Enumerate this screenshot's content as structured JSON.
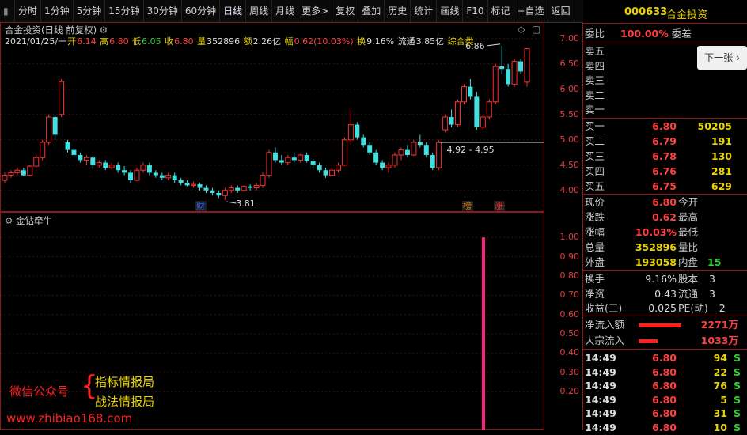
{
  "toolbar": {
    "items": [
      "分时",
      "1分钟",
      "5分钟",
      "15分钟",
      "30分钟",
      "60分钟",
      "日线",
      "周线",
      "月线",
      "更多>",
      "复权",
      "叠加",
      "历史",
      "统计",
      "画线",
      "F10",
      "标记",
      "+自选",
      "返回"
    ],
    "active": "日线"
  },
  "header": {
    "title": "合金投资(日线 前复权)",
    "date": "2021/01/25/一",
    "open_label": "开",
    "open": "6.14",
    "high_label": "高",
    "high": "6.80",
    "low_label": "低",
    "low": "6.05",
    "close_label": "收",
    "close": "6.80",
    "vol_label": "量",
    "vol": "352896",
    "amt_label": "额",
    "amt": "2.26亿",
    "chg_label": "幅",
    "chg": "0.62(10.03%)",
    "turn_label": "换",
    "turn": "9.16%",
    "float_label": "流通",
    "float": "3.85亿",
    "sector": "综合类"
  },
  "price_axis": [
    "7.00",
    "6.50",
    "6.00",
    "5.50",
    "5.00",
    "4.50",
    "4.00"
  ],
  "indicator": {
    "name": "金钻牵牛",
    "axis": [
      "1.00",
      "0.90",
      "0.80",
      "0.70",
      "0.60",
      "0.50",
      "0.40",
      "0.30",
      "0.20"
    ],
    "bar_value": 1.0
  },
  "annotations": {
    "high_mark": "6.86",
    "low_mark": "3.81",
    "range_label": "4.92 - 4.95",
    "tag_cai": "财",
    "tag_bang": "榜",
    "tag_zhang": "涨"
  },
  "chart_data": {
    "type": "candlestick",
    "ylim": [
      3.7,
      7.2
    ],
    "candles": [
      [
        4.2,
        4.35,
        4.15,
        4.3
      ],
      [
        4.3,
        4.4,
        4.25,
        4.35
      ],
      [
        4.35,
        4.45,
        4.3,
        4.4
      ],
      [
        4.4,
        4.45,
        4.28,
        4.3
      ],
      [
        4.3,
        4.5,
        4.28,
        4.48
      ],
      [
        4.48,
        4.7,
        4.45,
        4.65
      ],
      [
        4.65,
        5.0,
        4.6,
        4.95
      ],
      [
        4.95,
        5.5,
        4.9,
        5.45
      ],
      [
        5.45,
        5.5,
        5.0,
        5.1
      ],
      [
        5.5,
        6.2,
        5.45,
        6.15
      ],
      [
        4.95,
        5.0,
        4.75,
        4.8
      ],
      [
        4.8,
        4.85,
        4.65,
        4.7
      ],
      [
        4.7,
        4.75,
        4.55,
        4.6
      ],
      [
        4.6,
        4.7,
        4.5,
        4.65
      ],
      [
        4.65,
        4.68,
        4.45,
        4.5
      ],
      [
        4.5,
        4.6,
        4.45,
        4.55
      ],
      [
        4.55,
        4.6,
        4.4,
        4.45
      ],
      [
        4.45,
        4.55,
        4.4,
        4.5
      ],
      [
        4.5,
        4.55,
        4.35,
        4.4
      ],
      [
        4.4,
        4.48,
        4.3,
        4.35
      ],
      [
        4.35,
        4.4,
        4.15,
        4.2
      ],
      [
        4.2,
        4.45,
        4.18,
        4.4
      ],
      [
        4.4,
        4.55,
        4.35,
        4.5
      ],
      [
        4.5,
        4.55,
        4.3,
        4.35
      ],
      [
        4.35,
        4.4,
        4.25,
        4.3
      ],
      [
        4.3,
        4.35,
        4.2,
        4.25
      ],
      [
        4.25,
        4.35,
        4.2,
        4.3
      ],
      [
        4.3,
        4.35,
        4.15,
        4.2
      ],
      [
        4.2,
        4.25,
        4.1,
        4.15
      ],
      [
        4.15,
        4.2,
        4.08,
        4.1
      ],
      [
        4.1,
        4.18,
        4.05,
        4.12
      ],
      [
        4.12,
        4.15,
        4.0,
        4.05
      ],
      [
        4.05,
        4.1,
        3.95,
        4.0
      ],
      [
        4.0,
        4.05,
        3.9,
        3.95
      ],
      [
        3.95,
        4.0,
        3.85,
        3.9
      ],
      [
        3.9,
        4.05,
        3.81,
        4.0
      ],
      [
        4.0,
        4.1,
        3.95,
        4.05
      ],
      [
        4.05,
        4.1,
        3.95,
        4.0
      ],
      [
        4.0,
        4.1,
        3.98,
        4.08
      ],
      [
        4.08,
        4.12,
        4.0,
        4.05
      ],
      [
        4.05,
        4.15,
        4.0,
        4.1
      ],
      [
        4.1,
        4.35,
        4.05,
        4.3
      ],
      [
        4.3,
        4.8,
        4.25,
        4.75
      ],
      [
        4.75,
        4.85,
        4.55,
        4.6
      ],
      [
        4.6,
        4.7,
        4.5,
        4.55
      ],
      [
        4.55,
        4.7,
        4.5,
        4.65
      ],
      [
        4.65,
        4.75,
        4.55,
        4.6
      ],
      [
        4.6,
        4.72,
        4.55,
        4.7
      ],
      [
        4.7,
        4.75,
        4.55,
        4.58
      ],
      [
        4.58,
        4.62,
        4.45,
        4.5
      ],
      [
        4.5,
        4.55,
        4.35,
        4.4
      ],
      [
        4.4,
        4.45,
        4.25,
        4.3
      ],
      [
        4.3,
        4.45,
        4.28,
        4.4
      ],
      [
        4.4,
        4.55,
        4.35,
        4.5
      ],
      [
        4.5,
        5.05,
        4.48,
        5.0
      ],
      [
        5.0,
        5.6,
        4.9,
        5.3
      ],
      [
        5.3,
        5.35,
        5.0,
        5.05
      ],
      [
        5.05,
        5.1,
        4.85,
        4.9
      ],
      [
        4.9,
        4.95,
        4.7,
        4.75
      ],
      [
        4.75,
        4.8,
        4.5,
        4.55
      ],
      [
        4.55,
        4.6,
        4.4,
        4.45
      ],
      [
        4.45,
        4.55,
        4.35,
        4.5
      ],
      [
        4.5,
        4.75,
        4.45,
        4.7
      ],
      [
        4.7,
        4.85,
        4.6,
        4.8
      ],
      [
        4.8,
        4.9,
        4.65,
        4.7
      ],
      [
        4.7,
        5.0,
        4.68,
        4.95
      ],
      [
        4.95,
        5.1,
        4.85,
        4.9
      ],
      [
        4.9,
        4.95,
        4.65,
        4.7
      ],
      [
        4.7,
        4.75,
        4.4,
        4.45
      ],
      [
        4.45,
        5.0,
        4.4,
        4.95
      ],
      [
        5.2,
        5.5,
        5.15,
        5.45
      ],
      [
        5.45,
        5.6,
        5.25,
        5.3
      ],
      [
        5.3,
        5.8,
        5.25,
        5.75
      ],
      [
        5.75,
        6.1,
        5.7,
        6.05
      ],
      [
        6.05,
        6.2,
        5.8,
        5.85
      ],
      [
        5.85,
        5.95,
        5.2,
        5.25
      ],
      [
        5.25,
        5.5,
        5.2,
        5.45
      ],
      [
        5.45,
        5.8,
        5.4,
        5.75
      ],
      [
        5.75,
        6.5,
        5.7,
        6.45
      ],
      [
        6.45,
        6.86,
        6.3,
        6.4
      ],
      [
        6.4,
        6.5,
        6.05,
        6.1
      ],
      [
        6.1,
        6.6,
        6.05,
        6.55
      ],
      [
        6.55,
        6.6,
        6.3,
        6.35
      ],
      [
        6.14,
        6.8,
        6.05,
        6.8
      ]
    ]
  },
  "quote": {
    "code": "000633",
    "name": "合金投资",
    "wb_label": "委比",
    "wb": "100.00%",
    "wc_label": "委差",
    "next_label": "下一张",
    "sell_labels": [
      "卖五",
      "卖四",
      "卖三",
      "卖二",
      "卖一"
    ],
    "buy": [
      {
        "label": "买一",
        "price": "6.80",
        "vol": "50205"
      },
      {
        "label": "买二",
        "price": "6.79",
        "vol": "191"
      },
      {
        "label": "买三",
        "price": "6.78",
        "vol": "130"
      },
      {
        "label": "买四",
        "price": "6.76",
        "vol": "281"
      },
      {
        "label": "买五",
        "price": "6.75",
        "vol": "629"
      }
    ],
    "stats": [
      {
        "l": "现价",
        "v": "6.80",
        "r": "今开"
      },
      {
        "l": "涨跌",
        "v": "0.62",
        "r": "最高"
      },
      {
        "l": "涨幅",
        "v": "10.03%",
        "r": "最低"
      },
      {
        "l": "总量",
        "v": "352896",
        "r": "量比"
      },
      {
        "l": "外盘",
        "v": "193058",
        "r": "内盘",
        "rv": "15"
      }
    ],
    "stats2": [
      {
        "l": "换手",
        "v": "9.16%",
        "r": "股本",
        "rv": "3"
      },
      {
        "l": "净资",
        "v": "0.43",
        "r": "流通",
        "rv": "3"
      },
      {
        "l": "收益(三)",
        "v": "0.025",
        "r": "PE(动)",
        "rv": "2"
      }
    ],
    "flow": [
      {
        "l": "净流入额",
        "v": "2271万",
        "bar": 0.9
      },
      {
        "l": "大宗流入",
        "v": "1033万",
        "bar": 0.4
      }
    ],
    "ticks": [
      {
        "t": "14:49",
        "p": "6.80",
        "v": "94",
        "s": "S"
      },
      {
        "t": "14:49",
        "p": "6.80",
        "v": "22",
        "s": "S"
      },
      {
        "t": "14:49",
        "p": "6.80",
        "v": "76",
        "s": "S"
      },
      {
        "t": "14:49",
        "p": "6.80",
        "v": "5",
        "s": "S"
      },
      {
        "t": "14:49",
        "p": "6.80",
        "v": "31",
        "s": "S"
      },
      {
        "t": "14:49",
        "p": "6.80",
        "v": "10",
        "s": "S"
      }
    ]
  },
  "watermark": {
    "wechat": "微信公众号",
    "line1": "指标情报局",
    "line2": "战法情报局",
    "url": "www.zhibiao168.com"
  }
}
